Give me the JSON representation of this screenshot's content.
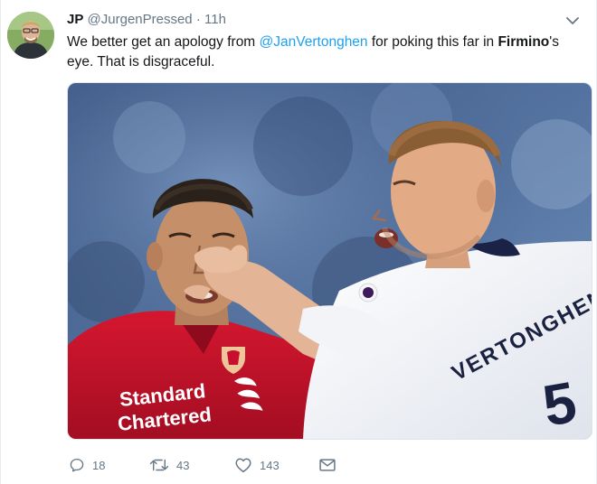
{
  "tweet": {
    "author": {
      "name": "JP",
      "handle": "@JurgenPressed",
      "separator": "·",
      "time": "11h"
    },
    "text": {
      "part1": "We better get an apology from ",
      "mention": "@JanVertonghen",
      "part2": " for poking this far in ",
      "bold": "Firmino",
      "part3": "'s eye. That is disgraceful."
    },
    "photo": {
      "sponsor_line1": "Standard",
      "sponsor_line2": "Chartered",
      "shirt_name": "VERTONGHEN",
      "shirt_number": "5"
    },
    "actions": {
      "replies": "18",
      "retweets": "43",
      "likes": "143"
    }
  },
  "icons": [
    "caret-down-icon",
    "reply-icon",
    "retweet-icon",
    "like-icon",
    "direct-message-icon"
  ],
  "colors": {
    "link": "#1da1f2",
    "secondary_text": "#657786",
    "liverpool_red": "#c8102e",
    "tottenham_white": "#f4f5f9"
  }
}
